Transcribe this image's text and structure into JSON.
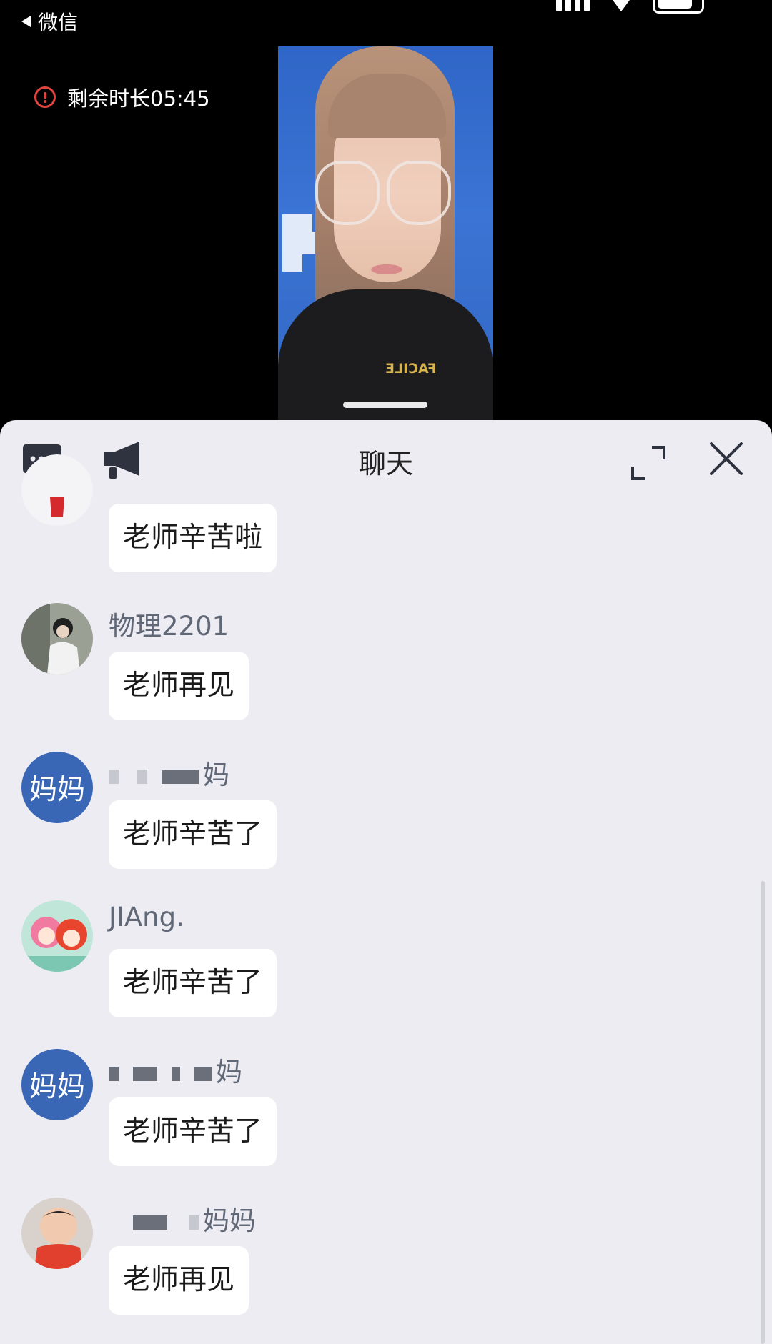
{
  "status_bar": {
    "back_label": "微信"
  },
  "live": {
    "timer_text": "剩余时长05:45"
  },
  "video": {
    "shirt_text": "FACILE"
  },
  "chat": {
    "title": "聊天",
    "messages": [
      {
        "sender": "",
        "text": "老师辛苦啦",
        "avatar": "photo-red"
      },
      {
        "sender": "物理2201",
        "text": "老师再见",
        "avatar": "photo-girl"
      },
      {
        "sender": "妈妈",
        "text": "老师辛苦了",
        "avatar_text": "妈妈",
        "avatar_visible_fragment": "妈"
      },
      {
        "sender": "JIAng.",
        "text": "老师辛苦了",
        "avatar": "cartoon-foxes"
      },
      {
        "sender": "妈妈",
        "text": "老师辛苦了",
        "avatar_text": "妈妈",
        "avatar_visible_fragment": "妈"
      },
      {
        "sender": "妈妈",
        "text": "老师再见",
        "avatar": "photo-child"
      }
    ]
  },
  "colors": {
    "accent": "#3a66b6",
    "panel_bg": "#ececf2",
    "warning": "#e0443e"
  }
}
